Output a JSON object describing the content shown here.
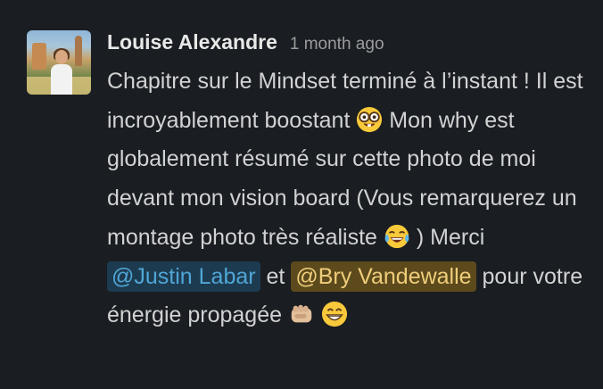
{
  "message": {
    "author": "Louise Alexandre",
    "timestamp": "1 month ago",
    "text_line_1": "Chapitre sur le Mindset terminé à l’instant ! Il est incroyablement boostant",
    "text_line_2": "Mon why est globalement résumé sur cette photo de moi devant mon vision board (Vous remarquerez un montage photo très réaliste",
    "text_line_3": ") Merci",
    "mention_1": "@Justin Labar",
    "connector": "et",
    "mention_2": "@Bry Vandewalle",
    "text_line_4": "pour votre énergie propagée",
    "emojis": [
      "nerd-face-emoji",
      "laughing-tears-emoji",
      "fist-bump-emoji",
      "grinning-face-emoji"
    ]
  },
  "colors": {
    "background": "#1a1d21",
    "text": "#d1d2d3",
    "mention_blue": "#4fa6d6",
    "mention_yellow": "#efcd7a"
  }
}
